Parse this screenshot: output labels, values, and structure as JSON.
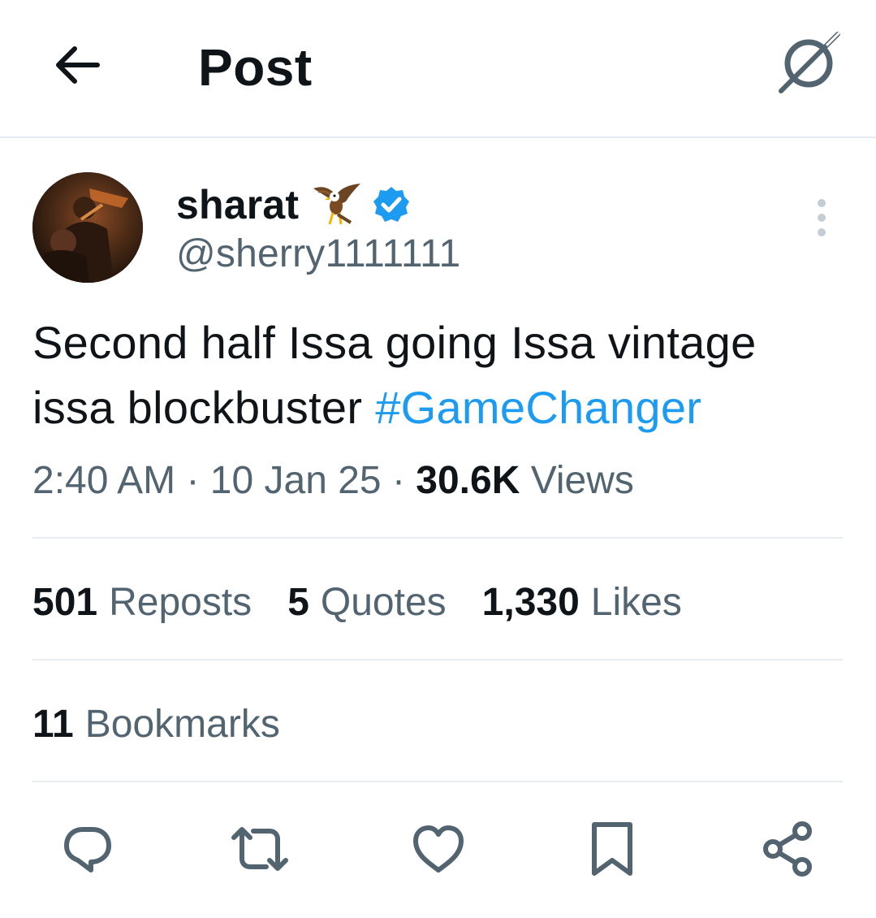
{
  "header": {
    "title": "Post",
    "back_icon": "arrow-left-icon",
    "grok_icon": "grok-icon"
  },
  "author": {
    "display_name": "sharat",
    "emoji": "🦅",
    "handle": "@sherry1111111",
    "verified": true,
    "verified_color": "#1d9bf0"
  },
  "tweet": {
    "text": "Second half Issa going Issa vintage issa blockbuster ",
    "hashtag": "#GameChanger",
    "hashtag_color": "#1d9bf0"
  },
  "meta": {
    "time": "2:40 AM",
    "sep1": " · ",
    "date": "10 Jan 25",
    "sep2": " · ",
    "views_count": "30.6K",
    "views_label": "Views"
  },
  "stats": {
    "reposts_count": "501",
    "reposts_label": "Reposts",
    "quotes_count": "5",
    "quotes_label": "Quotes",
    "likes_count": "1,330",
    "likes_label": "Likes"
  },
  "bookmarks": {
    "count": "11",
    "label": "Bookmarks"
  },
  "actions": [
    "reply-icon",
    "repost-icon",
    "like-icon",
    "bookmark-icon",
    "share-icon"
  ],
  "colors": {
    "text_primary": "#0f1419",
    "text_secondary": "#536471",
    "divider": "#e6ecf0",
    "icon": "#536471"
  }
}
